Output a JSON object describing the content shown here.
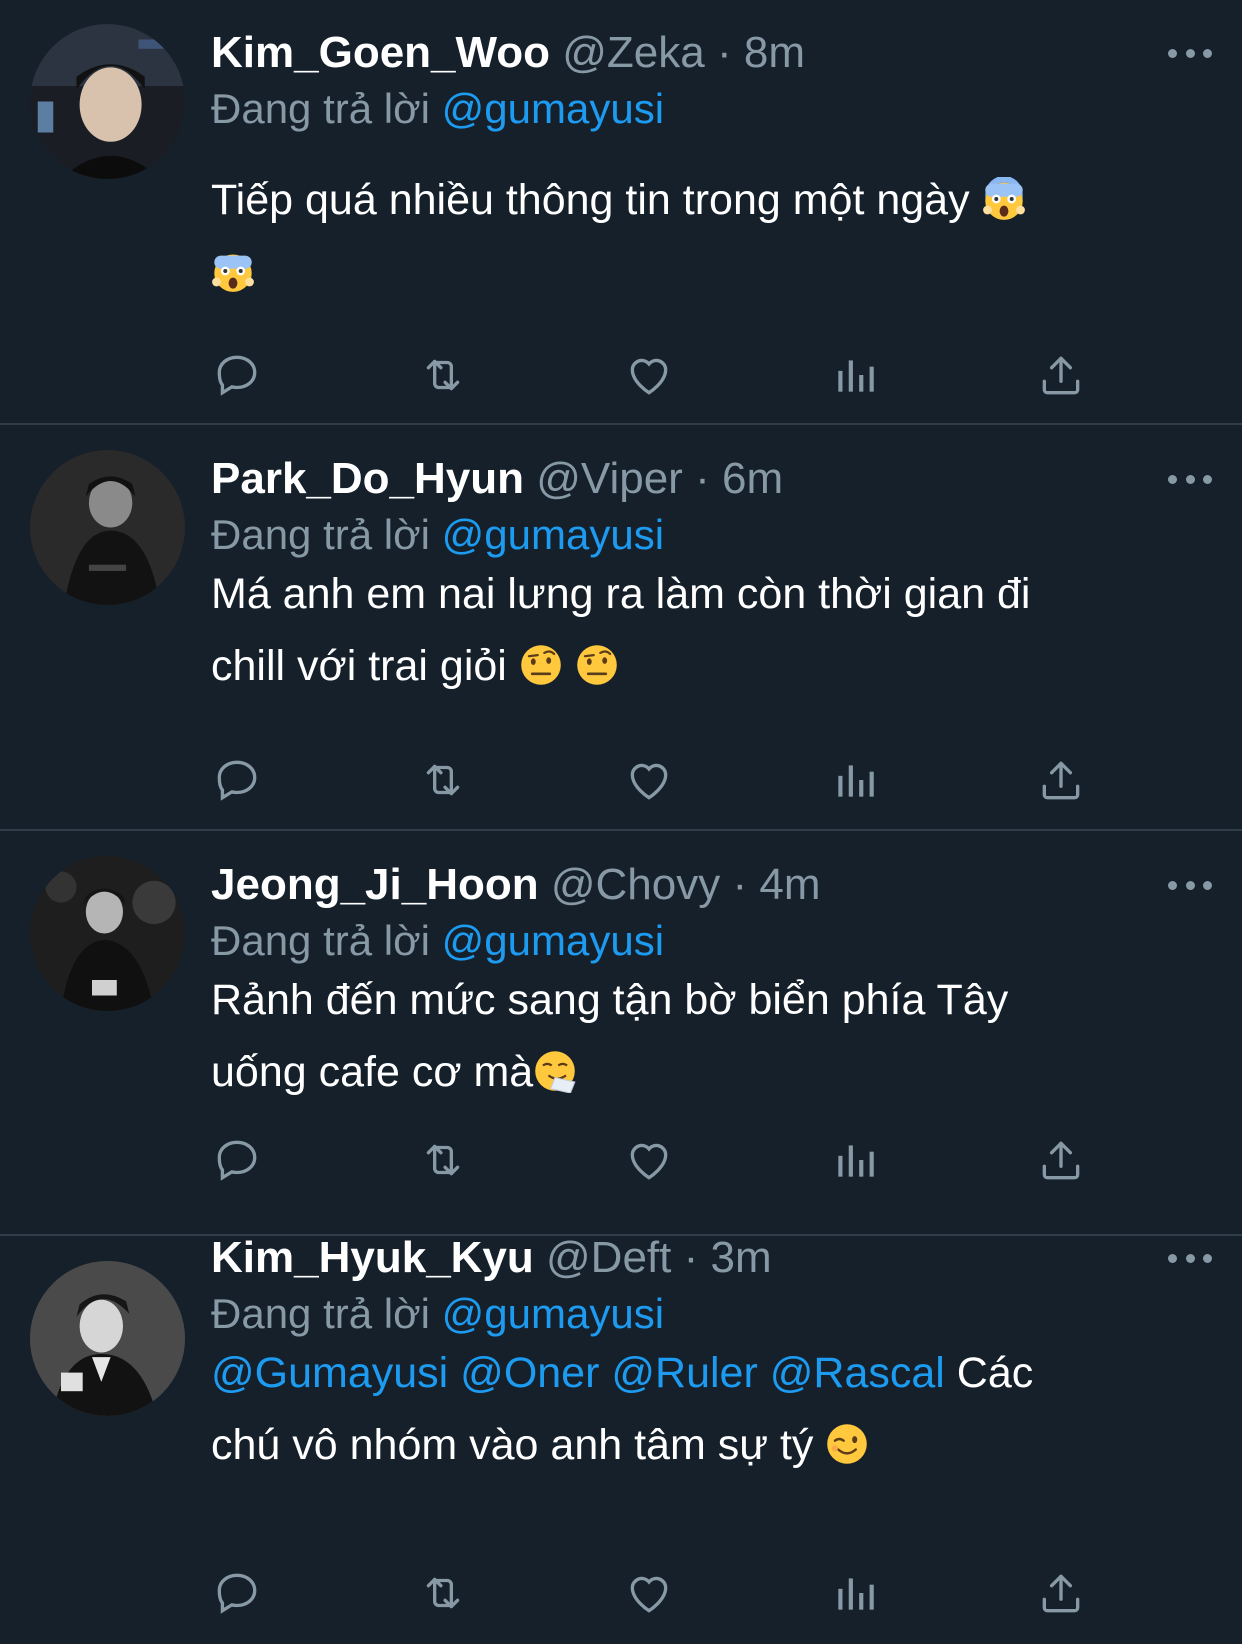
{
  "tweets": [
    {
      "name": "Kim_Goen_Woo",
      "handle": "@Zeka",
      "sep": "·",
      "time": "8m",
      "reply_prefix": "Đang trả lời",
      "reply_to": "@gumayusi",
      "text_1": "Tiếp quá nhiều thông tin trong một ngày",
      "emoji_1": "face-screaming-in-fear",
      "emoji_2": "face-screaming-in-fear"
    },
    {
      "name": "Park_Do_Hyun",
      "handle": "@Viper",
      "sep": "·",
      "time": "6m",
      "reply_prefix": "Đang trả lời",
      "reply_to": "@gumayusi",
      "text_line1": "Má anh em nai lưng ra làm còn thời gian đi",
      "text_line2": "chill với trai giỏi",
      "emoji_1": "face-with-raised-eyebrow",
      "emoji_2": "face-with-raised-eyebrow"
    },
    {
      "name": "Jeong_Ji_Hoon",
      "handle": "@Chovy",
      "sep": "·",
      "time": "4m",
      "reply_prefix": "Đang trả lời",
      "reply_to": "@gumayusi",
      "text_line1": "Rảnh đến mức sang tận bờ biển phía Tây",
      "text_line2": "uống cafe cơ mà",
      "emoji_1": "sneezing-face"
    },
    {
      "name": "Kim_Hyuk_Kyu",
      "handle": "@Deft",
      "sep": "·",
      "time": "3m",
      "reply_prefix": "Đang trả lời",
      "reply_to": "@gumayusi",
      "mentions": [
        "@Gumayusi",
        "@Oner",
        "@Ruler",
        "@Rascal"
      ],
      "text_after_mentions": "Các",
      "text_line2": "chú vô nhóm vào anh tâm sự tý",
      "emoji_1": "winking-face"
    }
  ],
  "icons": {
    "reply": "reply-icon",
    "retweet": "retweet-icon",
    "like": "heart-icon",
    "analytics": "analytics-icon",
    "share": "share-icon",
    "more": "more-options-icon"
  },
  "colors": {
    "background": "#15202b",
    "secondary_text": "#8899a6",
    "mention": "#1d9bf0",
    "divider": "#2f3c49"
  }
}
